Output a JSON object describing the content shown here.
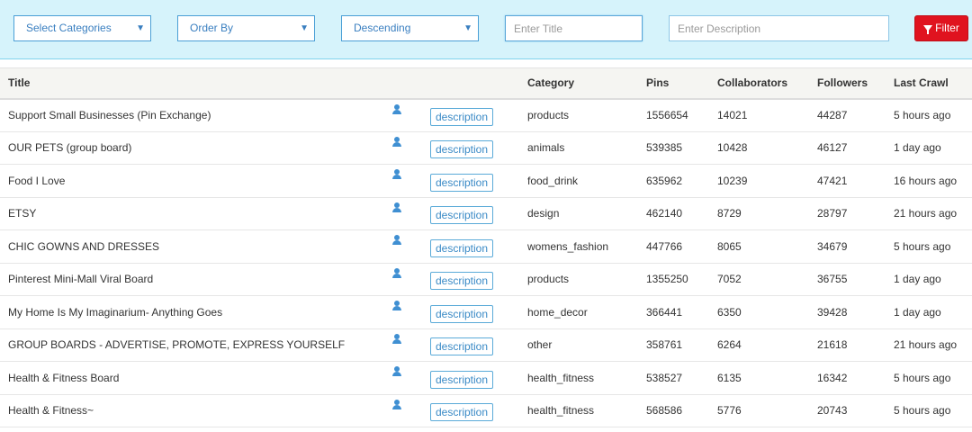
{
  "filters": {
    "categories_label": "Select Categories",
    "order_by_label": "Order By",
    "direction_label": "Descending",
    "title_placeholder": "Enter Title",
    "description_placeholder": "Enter Description",
    "filter_button_label": "Filter"
  },
  "table": {
    "headers": {
      "title": "Title",
      "category": "Category",
      "pins": "Pins",
      "collaborators": "Collaborators",
      "followers": "Followers",
      "last_crawl": "Last Crawl"
    },
    "description_label": "description",
    "rows": [
      {
        "title": "Support Small Businesses (Pin Exchange)",
        "category": "products",
        "pins": "1556654",
        "collaborators": "14021",
        "followers": "44287",
        "last_crawl": "5 hours ago"
      },
      {
        "title": "OUR PETS (group board)",
        "category": "animals",
        "pins": "539385",
        "collaborators": "10428",
        "followers": "46127",
        "last_crawl": "1 day ago"
      },
      {
        "title": "Food I Love",
        "category": "food_drink",
        "pins": "635962",
        "collaborators": "10239",
        "followers": "47421",
        "last_crawl": "16 hours ago"
      },
      {
        "title": "ETSY",
        "category": "design",
        "pins": "462140",
        "collaborators": "8729",
        "followers": "28797",
        "last_crawl": "21 hours ago"
      },
      {
        "title": "CHIC GOWNS AND DRESSES",
        "category": "womens_fashion",
        "pins": "447766",
        "collaborators": "8065",
        "followers": "34679",
        "last_crawl": "5 hours ago"
      },
      {
        "title": "Pinterest Mini-Mall Viral Board",
        "category": "products",
        "pins": "1355250",
        "collaborators": "7052",
        "followers": "36755",
        "last_crawl": "1 day ago"
      },
      {
        "title": "My Home Is My Imaginarium- Anything Goes",
        "category": "home_decor",
        "pins": "366441",
        "collaborators": "6350",
        "followers": "39428",
        "last_crawl": "1 day ago"
      },
      {
        "title": "GROUP BOARDS - ADVERTISE, PROMOTE, EXPRESS YOURSELF",
        "category": "other",
        "pins": "358761",
        "collaborators": "6264",
        "followers": "21618",
        "last_crawl": "21 hours ago"
      },
      {
        "title": "Health & Fitness Board",
        "category": "health_fitness",
        "pins": "538527",
        "collaborators": "6135",
        "followers": "16342",
        "last_crawl": "5 hours ago"
      },
      {
        "title": "Health & Fitness~",
        "category": "health_fitness",
        "pins": "568586",
        "collaborators": "5776",
        "followers": "20743",
        "last_crawl": "5 hours ago"
      }
    ]
  },
  "icons": {
    "user": "user-icon",
    "filter": "filter-funnel-icon",
    "caret": "caret-down-icon"
  },
  "colors": {
    "filter_bar_bg": "#d6f3fb",
    "filter_button": "#e0131f",
    "accent_blue": "#3a7fc0"
  }
}
